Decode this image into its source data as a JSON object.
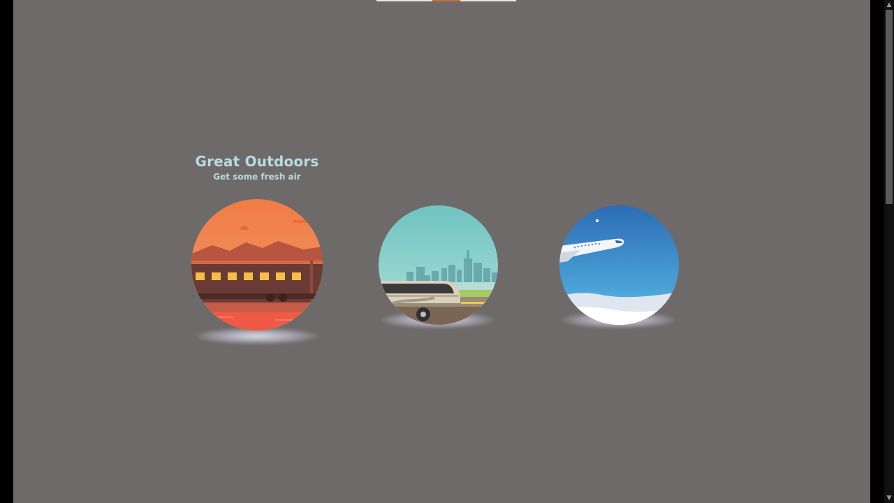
{
  "featured": {
    "title": "Great Outdoors",
    "subtitle": "Get some fresh air"
  },
  "cards": [
    {
      "name": "train",
      "illustration": "train-sunset-icon"
    },
    {
      "name": "bus",
      "illustration": "bus-city-icon"
    },
    {
      "name": "plane",
      "illustration": "plane-clouds-icon"
    }
  ],
  "colors": {
    "page_background": "#6e6a69",
    "caption_text": "#b7dbe2",
    "window_frame": "#000000"
  }
}
